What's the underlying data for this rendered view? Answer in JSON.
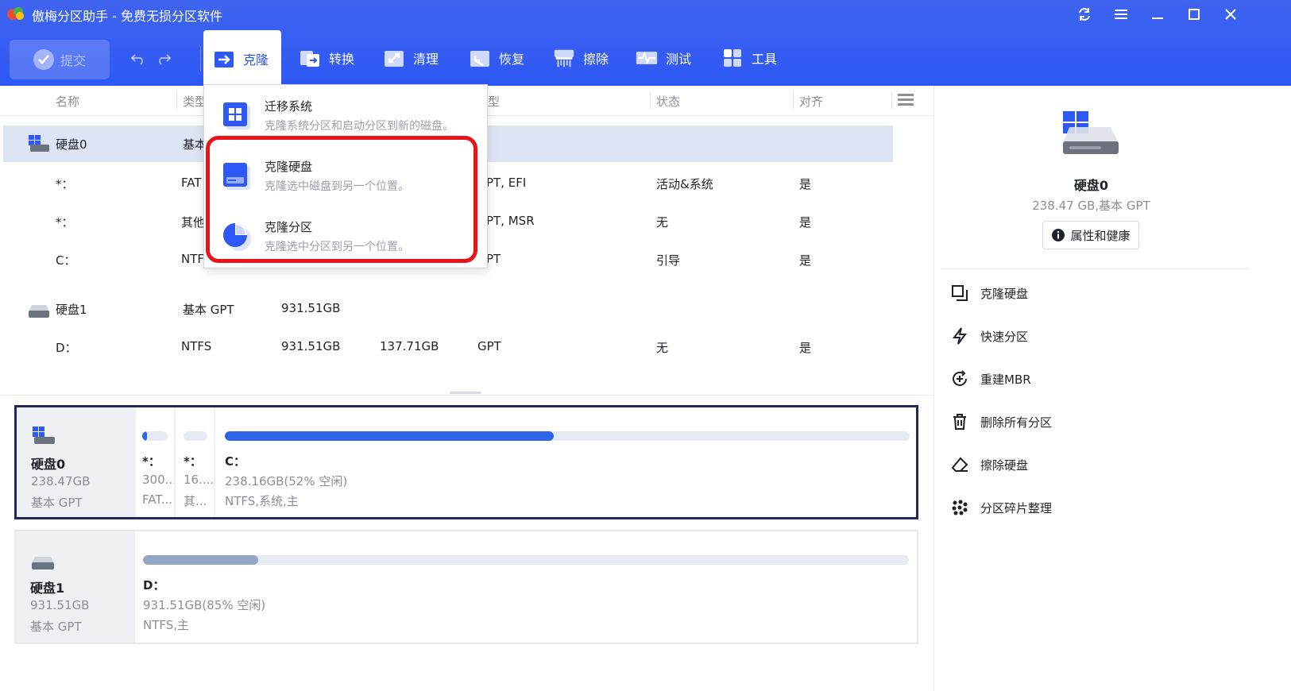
{
  "app": {
    "title": "傲梅分区助手 - 免费无损分区软件"
  },
  "toolbar": {
    "commit_label": "提交",
    "tools": [
      {
        "label": "克隆",
        "icon": "clone-icon",
        "active": true
      },
      {
        "label": "转换",
        "icon": "convert-icon"
      },
      {
        "label": "清理",
        "icon": "cleanup-icon"
      },
      {
        "label": "恢复",
        "icon": "recover-icon"
      },
      {
        "label": "擦除",
        "icon": "wipe-icon"
      },
      {
        "label": "测试",
        "icon": "test-icon"
      },
      {
        "label": "工具",
        "icon": "tools-icon"
      }
    ]
  },
  "clone_menu": {
    "items": [
      {
        "title": "迁移系统",
        "desc": "克隆系统分区和启动分区到新的磁盘。"
      },
      {
        "title": "克隆硬盘",
        "desc": "克隆选中磁盘到另一个位置。"
      },
      {
        "title": "克隆分区",
        "desc": "克隆选中分区到另一个位置。"
      }
    ]
  },
  "table": {
    "columns": [
      "名称",
      "类型",
      "型",
      "状态",
      "对齐"
    ],
    "rows": [
      {
        "name": "硬盘0",
        "type": "基本",
        "capacity": "",
        "used": "",
        "fs": "",
        "status": "",
        "align": ""
      },
      {
        "name": "*：",
        "type": "FAT",
        "capacity": "",
        "used": "",
        "fs": "PT, EFI",
        "status": "活动&系统",
        "align": "是"
      },
      {
        "name": "*：",
        "type": "其他",
        "capacity": "",
        "used": "",
        "fs": "PT, MSR",
        "status": "无",
        "align": "是"
      },
      {
        "name": "C：",
        "type": "NTF",
        "capacity": "",
        "used": "",
        "fs": "PT",
        "status": "引导",
        "align": "是"
      },
      {
        "name": "硬盘1",
        "type": "基本 GPT",
        "capacity": "931.51GB",
        "used": "",
        "fs": "",
        "status": "",
        "align": ""
      },
      {
        "name": "D：",
        "type": "NTFS",
        "capacity": "931.51GB",
        "used": "137.71GB",
        "fs": "GPT",
        "status": "无",
        "align": "是"
      }
    ]
  },
  "diskmap": {
    "disk0": {
      "name": "硬盘0",
      "size": "238.47GB",
      "type": "基本 GPT",
      "parts": [
        {
          "label": "*：",
          "sub1": "300...",
          "sub2": "FAT...",
          "fill": 0.2
        },
        {
          "label": "*：",
          "sub1": "16....",
          "sub2": "其...",
          "fill": 0
        },
        {
          "label": "C：",
          "sub1": "238.16GB(52% 空闲)",
          "sub2": "NTFS,系统,主",
          "fill": 0.48
        }
      ]
    },
    "disk1": {
      "name": "硬盘1",
      "size": "931.51GB",
      "type": "基本 GPT",
      "parts": [
        {
          "label": "D：",
          "sub1": "931.51GB(85% 空闲)",
          "sub2": "NTFS,主",
          "fill": 0.15
        }
      ]
    }
  },
  "right_panel": {
    "disk_name": "硬盘0",
    "disk_info": "238.47 GB,基本 GPT",
    "props_button": "属性和健康",
    "actions": [
      "克隆硬盘",
      "快速分区",
      "重建MBR",
      "删除所有分区",
      "擦除硬盘",
      "分区碎片整理"
    ]
  },
  "colors": {
    "accent": "#2e58f5",
    "bar_used": "#2f63e8",
    "bar_used_disk1": "#93a6c4",
    "highlight": "#e8141a"
  }
}
